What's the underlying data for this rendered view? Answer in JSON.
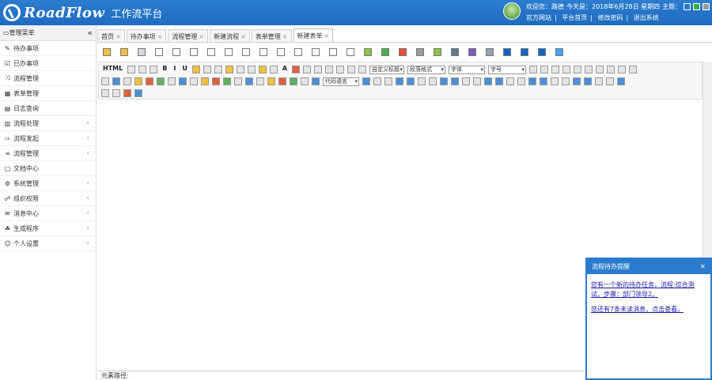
{
  "header": {
    "logo_text": "RoadFlow",
    "subtitle": "工作流平台",
    "welcome": "欢迎您：路德",
    "today": "今天是：2018年6月28日 星期四",
    "theme_label": "主题：",
    "links": [
      "官方网站",
      "平台首页",
      "修改密码",
      "退出系统"
    ],
    "theme_colors": [
      "#2c7cd0",
      "#3cb043",
      "#9e9e9e"
    ]
  },
  "sidebar": {
    "title": "管理菜单",
    "collapse": "«",
    "items": [
      {
        "label": "待办事项",
        "icon": "✎",
        "arrow": ""
      },
      {
        "label": "已办事项",
        "icon": "☑",
        "arrow": ""
      },
      {
        "label": "流程管理",
        "icon": "⤨",
        "arrow": ""
      },
      {
        "label": "表单管理",
        "icon": "▦",
        "arrow": ""
      },
      {
        "label": "日志查询",
        "icon": "▤",
        "arrow": ""
      },
      {
        "label": "流程处理",
        "icon": "▥",
        "arrow": "‹"
      },
      {
        "label": "流程发起",
        "icon": "⇨",
        "arrow": "‹"
      },
      {
        "label": "流程管理",
        "icon": "⋖",
        "arrow": "‹"
      },
      {
        "label": "文档中心",
        "icon": "▢",
        "arrow": ""
      },
      {
        "label": "系统管理",
        "icon": "⚙",
        "arrow": "‹"
      },
      {
        "label": "组织权限",
        "icon": "☍",
        "arrow": "‹"
      },
      {
        "label": "消息中心",
        "icon": "✉",
        "arrow": "‹"
      },
      {
        "label": "生成程序",
        "icon": "☘",
        "arrow": "‹"
      },
      {
        "label": "个人设置",
        "icon": "☺",
        "arrow": "‹"
      }
    ]
  },
  "tabs": [
    {
      "label": "首页",
      "active": false
    },
    {
      "label": "待办事项",
      "active": false
    },
    {
      "label": "流程管理",
      "active": false
    },
    {
      "label": "新建流程",
      "active": false
    },
    {
      "label": "表单管理",
      "active": false
    },
    {
      "label": "新建表单",
      "active": true
    }
  ],
  "editor": {
    "html_btn": "HTML",
    "selects": [
      "自定义标题",
      "段落格式",
      "字体",
      "字号",
      "代码语言"
    ]
  },
  "status_bar": {
    "label": "元素路径:"
  },
  "popup": {
    "title": "流程待办提醒",
    "close": "×",
    "message1": "您有一个新的待办任务，流程:综合测试，步骤：部门领导2。",
    "message2": "您还有7条未读消息，点击查看。"
  }
}
